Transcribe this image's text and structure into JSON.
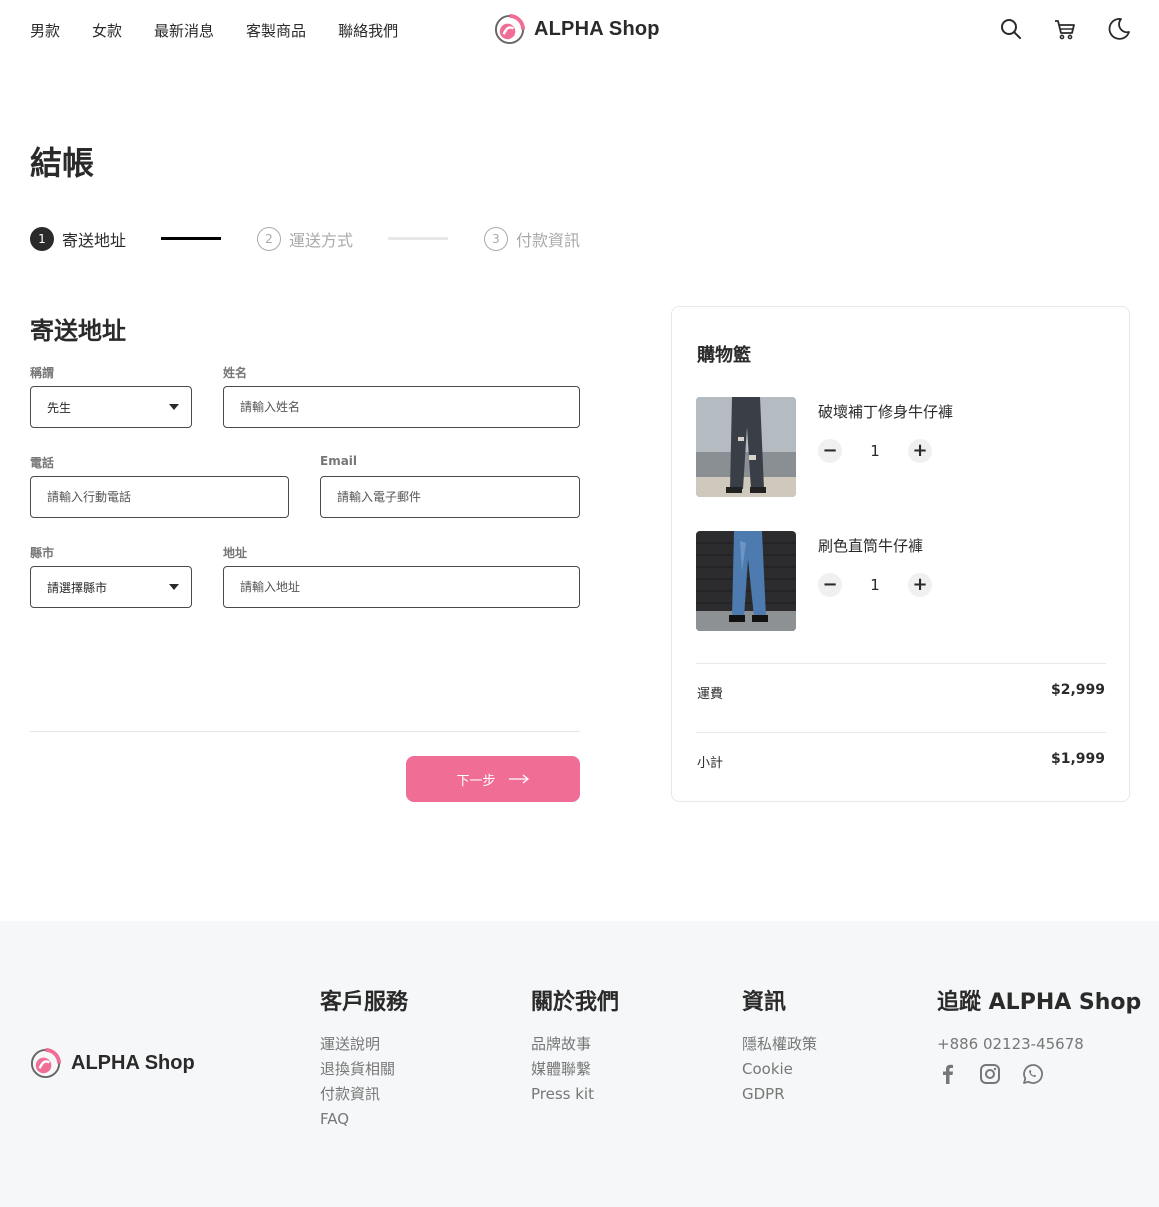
{
  "header": {
    "nav": [
      "男款",
      "女款",
      "最新消息",
      "客製商品",
      "聯絡我們"
    ],
    "logo_text": "ALPHA Shop"
  },
  "page": {
    "title": "結帳"
  },
  "stepper": {
    "steps": [
      {
        "num": "1",
        "label": "寄送地址",
        "state": "active"
      },
      {
        "num": "2",
        "label": "運送方式",
        "state": "pending"
      },
      {
        "num": "3",
        "label": "付款資訊",
        "state": "pending"
      }
    ]
  },
  "form": {
    "title": "寄送地址",
    "salutation": {
      "label": "稱謂",
      "value": "先生"
    },
    "name": {
      "label": "姓名",
      "placeholder": "請輸入姓名"
    },
    "phone": {
      "label": "電話",
      "placeholder": "請輸入行動電話"
    },
    "email": {
      "label": "Email",
      "placeholder": "請輸入電子郵件"
    },
    "city": {
      "label": "縣市",
      "value": "請選擇縣市"
    },
    "address": {
      "label": "地址",
      "placeholder": "請輸入地址"
    },
    "next_label": "下一步"
  },
  "cart": {
    "title": "購物籃",
    "items": [
      {
        "name": "破壞補丁修身牛仔褲",
        "qty": "1"
      },
      {
        "name": "刷色直筒牛仔褲",
        "qty": "1"
      }
    ],
    "shipping": {
      "label": "運費",
      "value": "$2,999"
    },
    "subtotal": {
      "label": "小計",
      "value": "$1,999"
    }
  },
  "footer": {
    "logo_text": "ALPHA Shop",
    "columns": [
      {
        "title": "客戶服務",
        "links": [
          "運送說明",
          "退換貨相關",
          "付款資訊",
          "FAQ"
        ]
      },
      {
        "title": "關於我們",
        "links": [
          "品牌故事",
          "媒體聯繫",
          "Press kit"
        ]
      },
      {
        "title": "資訊",
        "links": [
          "隱私權政策",
          "Cookie",
          "GDPR"
        ]
      }
    ],
    "follow": {
      "title": "追蹤 ALPHA Shop",
      "phone": "+886 02123-45678"
    }
  },
  "colors": {
    "accent": "#f06e95",
    "text": "#2a2a2a",
    "muted": "#777777",
    "footer_bg": "#f6f7f8"
  },
  "icons": [
    "search-icon",
    "cart-icon",
    "moon-icon",
    "arrow-right-icon",
    "facebook-icon",
    "instagram-icon",
    "whatsapp-icon"
  ]
}
